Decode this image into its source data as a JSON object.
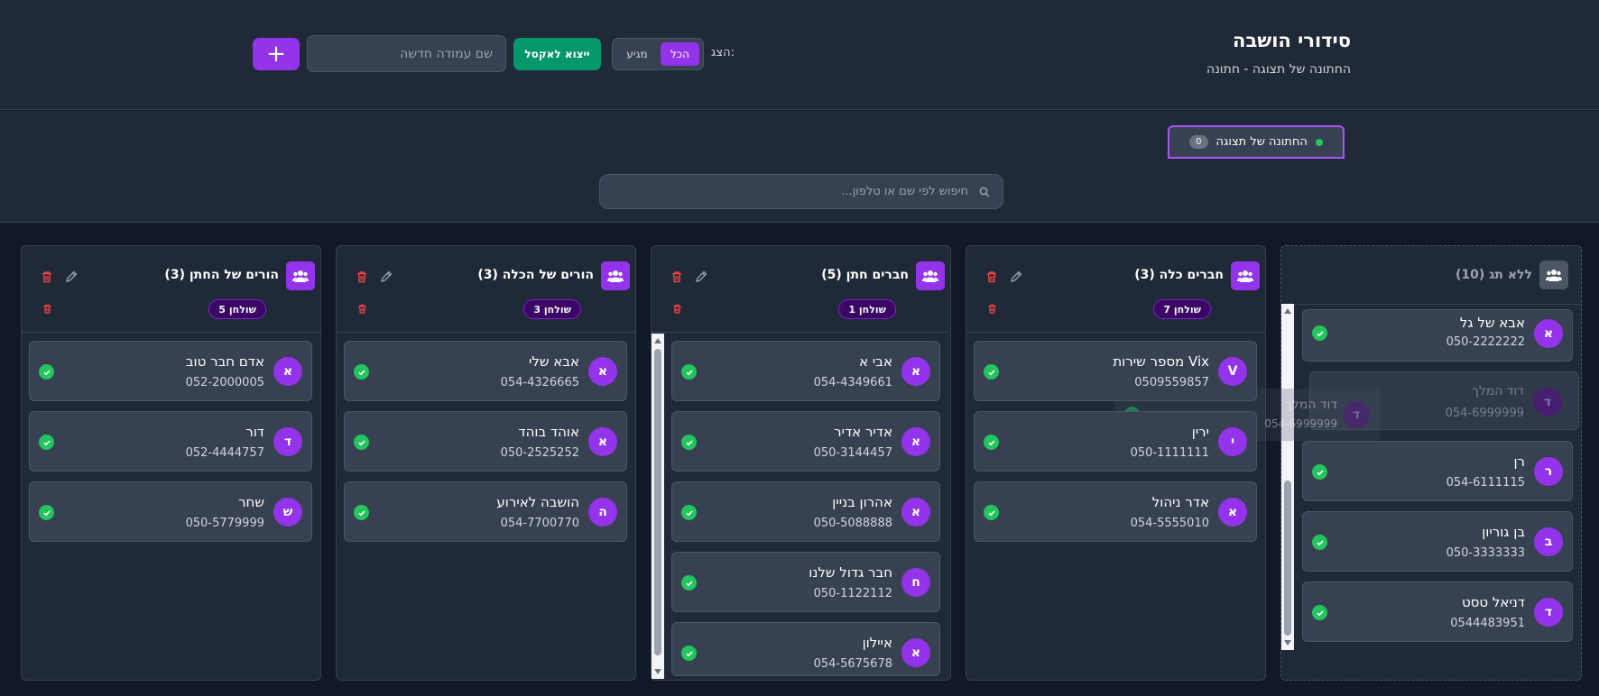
{
  "header": {
    "title": "סידורי הושבה",
    "subtitle": "החתונה של תצוגה - חתונה",
    "filter_label": "הצג:",
    "filter_all": "הכל",
    "filter_arriving": "מגיע",
    "export_label": "ייצוא לאקסל",
    "new_column_placeholder": "שם עמודה חדשה",
    "add_label": "+"
  },
  "event_tab": {
    "label": "החתונה של תצוגה",
    "count": "0"
  },
  "search": {
    "placeholder": "חיפוש לפי שם או טלפון..."
  },
  "columns": [
    {
      "title": "הורים של החתן (3)",
      "table_badge": "שולחן 5",
      "guests": [
        {
          "initial": "א",
          "name": "אדם חבר טוב",
          "phone": "052-2000005"
        },
        {
          "initial": "ד",
          "name": "דור",
          "phone": "052-4444757"
        },
        {
          "initial": "ש",
          "name": "שחר",
          "phone": "050-5779999"
        }
      ]
    },
    {
      "title": "הורים של הכלה (3)",
      "table_badge": "שולחן 3",
      "guests": [
        {
          "initial": "א",
          "name": "אבא שלי",
          "phone": "054-4326665"
        },
        {
          "initial": "א",
          "name": "אוהד בוהד",
          "phone": "050-2525252"
        },
        {
          "initial": "ה",
          "name": "הושבה לאירוע",
          "phone": "054-7700770"
        }
      ]
    },
    {
      "title": "חברים חתן (5)",
      "table_badge": "שולחן 1",
      "guests": [
        {
          "initial": "א",
          "name": "אבי א",
          "phone": "054-4349661"
        },
        {
          "initial": "א",
          "name": "אדיר אדיר",
          "phone": "050-3144457"
        },
        {
          "initial": "א",
          "name": "אהרון בניין",
          "phone": "050-5088888"
        },
        {
          "initial": "ח",
          "name": "חבר גדול שלנו",
          "phone": "050-1122112"
        },
        {
          "initial": "א",
          "name": "איילון",
          "phone": "054-5675678"
        }
      ]
    },
    {
      "title": "חברים כלה (3)",
      "table_badge": "שולחן 7",
      "guests": [
        {
          "initial": "V",
          "name": "Vix מספר שירות",
          "phone": "0509559857"
        },
        {
          "initial": "י",
          "name": "ירין",
          "phone": "050-1111111"
        },
        {
          "initial": "א",
          "name": "אדר ניהול",
          "phone": "054-5555010"
        }
      ]
    }
  ],
  "untagged": {
    "title": "ללא תג (10)",
    "guests": [
      {
        "initial": "א",
        "name": "אבא של גל",
        "phone": "050-2222222"
      },
      {
        "initial": "ר",
        "name": "רן",
        "phone": "054-6111115"
      },
      {
        "initial": "ב",
        "name": "בן גוריון",
        "phone": "050-3333333"
      },
      {
        "initial": "ד",
        "name": "דניאל טסט",
        "phone": "0544483951"
      }
    ],
    "placeholder_guest": {
      "initial": "ד",
      "name": "דוד המלך",
      "phone": "054-6999999"
    }
  },
  "drag_ghost": {
    "initial": "ד",
    "name": "דוד המלך",
    "phone": "054-6999999"
  },
  "colors": {
    "accent": "#9333ea",
    "export": "#059669",
    "check": "#22c55e",
    "background": "#111827",
    "panel": "#1f2937"
  }
}
